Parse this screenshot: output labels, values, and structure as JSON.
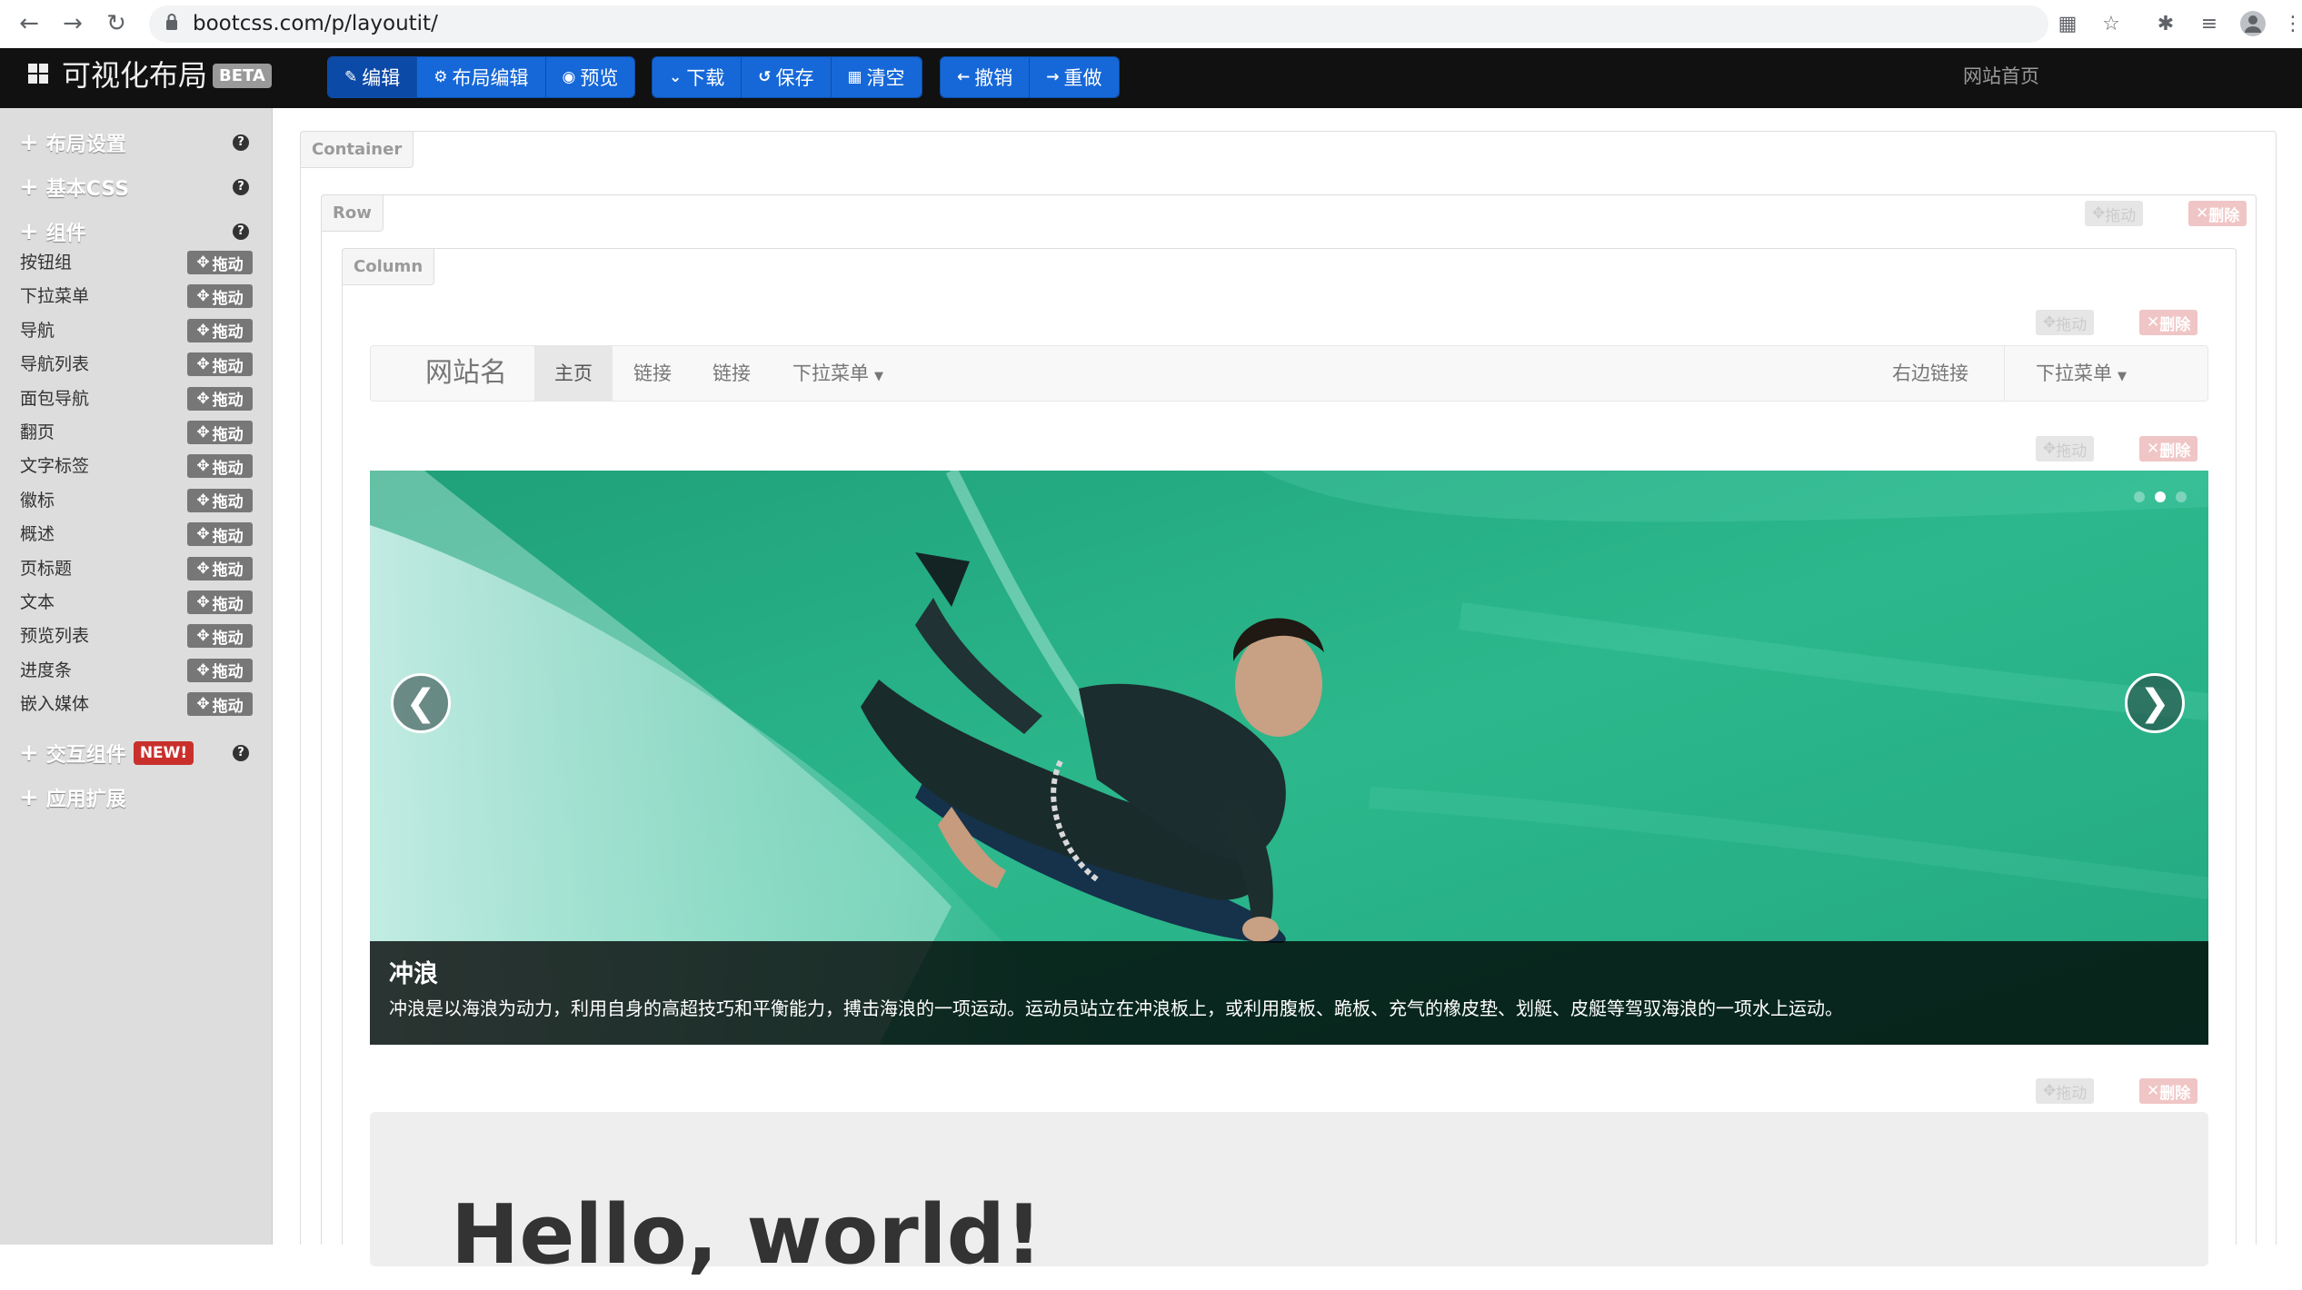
{
  "browser": {
    "url": "bootcss.com/p/layoutit/"
  },
  "app": {
    "brand": "可视化布局",
    "beta": "BETA",
    "home_link": "网站首页",
    "toolbar": {
      "group1": [
        "编辑",
        "布局编辑",
        "预览"
      ],
      "group2": [
        "下载",
        "保存",
        "清空"
      ],
      "group3": [
        "撤销",
        "重做"
      ]
    }
  },
  "sidebar": {
    "sections": {
      "layout": "布局设置",
      "css": "基本CSS",
      "components": "组件",
      "interactive": "交互组件",
      "interactive_badge": "NEW!",
      "extensions": "应用扩展"
    },
    "help_glyph": "?",
    "drag_label": "拖动",
    "components": [
      "按钮组",
      "下拉菜单",
      "导航",
      "导航列表",
      "面包导航",
      "翻页",
      "文字标签",
      "徽标",
      "概述",
      "页标题",
      "文本",
      "预览列表",
      "进度条",
      "嵌入媒体"
    ]
  },
  "canvas": {
    "container_tag": "Container",
    "row_tag": "Row",
    "column_tag": "Column",
    "drag_label": "拖动",
    "delete_label": "删除",
    "navbar": {
      "brand": "网站名",
      "items": [
        "主页",
        "链接",
        "链接"
      ],
      "dropdown": "下拉菜单",
      "right_link": "右边链接",
      "right_dropdown": "下拉菜单"
    },
    "carousel": {
      "prev_glyph": "❮",
      "next_glyph": "❯",
      "active_dot": 1,
      "caption_title": "冲浪",
      "caption_text": "冲浪是以海浪为动力，利用自身的高超技巧和平衡能力，搏击海浪的一项运动。运动员站立在冲浪板上，或利用腹板、跪板、充气的橡皮垫、划艇、皮艇等驾驭海浪的一项水上运动。"
    },
    "jumbotron": {
      "title": "Hello, world!"
    }
  },
  "colors": {
    "toolbar_blue": "#1668d8",
    "topbar": "#111111",
    "sidebar": "#dddddd",
    "wave_green": "#2fb387"
  }
}
